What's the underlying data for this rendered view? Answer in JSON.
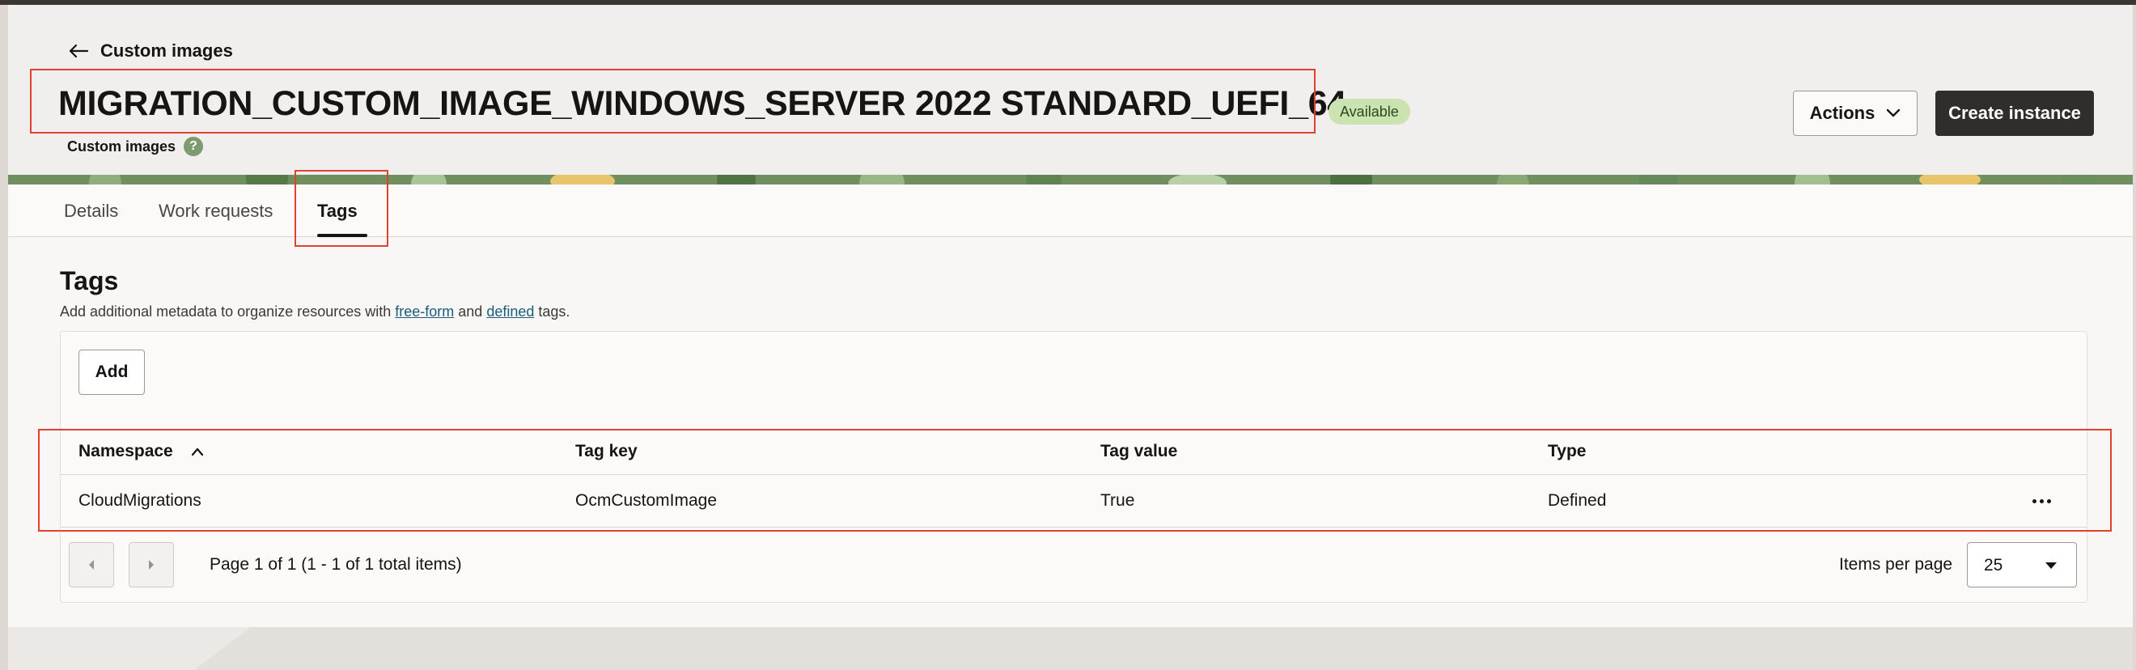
{
  "header": {
    "back_label": "Custom images",
    "title": "MIGRATION_CUSTOM_IMAGE_WINDOWS_SERVER 2022 STANDARD_UEFI_64",
    "status_badge": "Available",
    "subtitle": "Custom images",
    "help_glyph": "?",
    "actions_label": "Actions",
    "create_label": "Create instance"
  },
  "tabs": [
    {
      "label": "Details"
    },
    {
      "label": "Work requests"
    },
    {
      "label": "Tags"
    }
  ],
  "active_tab": "Tags",
  "tags_section": {
    "title": "Tags",
    "desc_prefix": "Add additional metadata to organize resources with ",
    "link_free_form": "free-form",
    "desc_and": " and ",
    "link_defined": "defined",
    "desc_suffix": " tags.",
    "add_label": "Add"
  },
  "table": {
    "columns": [
      "Namespace",
      "Tag key",
      "Tag value",
      "Type"
    ],
    "sorted_column": "Namespace",
    "sort_direction": "ascending",
    "rows": [
      [
        "CloudMigrations",
        "OcmCustomImage",
        "True",
        "Defined"
      ]
    ]
  },
  "pagination": {
    "summary": "Page 1 of 1 (1 - 1 of 1 total items)",
    "items_per_page_label": "Items per page",
    "items_per_page_value": "25"
  },
  "colors": {
    "annotation": "#e0422e",
    "primary_button": "#312d2a",
    "badge_bg": "#cbe2b1",
    "link": "#1a5c7a"
  }
}
